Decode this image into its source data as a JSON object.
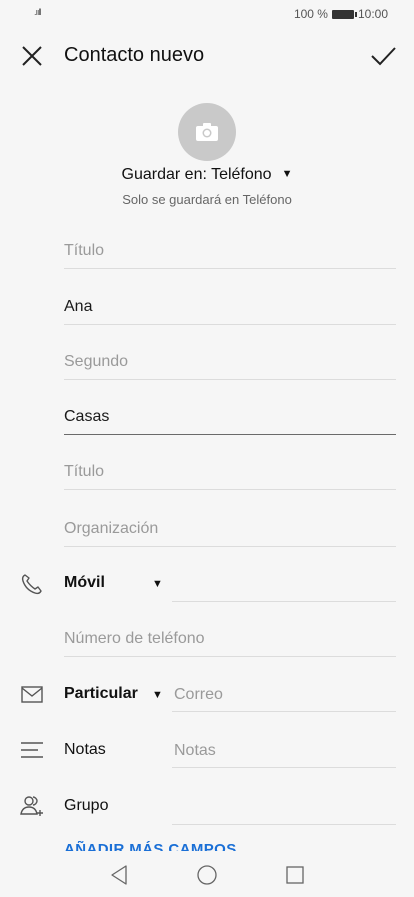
{
  "status": {
    "battery_text": "100 %",
    "time": "10:00",
    "signal": ".ııll"
  },
  "header": {
    "title": "Contacto nuevo"
  },
  "save_location": {
    "label": "Guardar en: Teléfono",
    "caret": "▼",
    "note": "Solo se guardará en Teléfono"
  },
  "fields": {
    "prefix": {
      "placeholder": "Título",
      "value": ""
    },
    "first_name": {
      "placeholder": "",
      "value": "Ana"
    },
    "middle_name": {
      "placeholder": "Segundo",
      "value": ""
    },
    "last_name": {
      "placeholder": "",
      "value": "Casas"
    },
    "suffix": {
      "placeholder": "Título",
      "value": ""
    },
    "organization": {
      "placeholder": "Organización",
      "value": ""
    }
  },
  "phone": {
    "type_label": "Móvil",
    "caret": "▼",
    "placeholder": "Número de teléfono"
  },
  "email": {
    "type_label": "Particular",
    "caret": "▼",
    "placeholder": "Correo"
  },
  "notes": {
    "label": "Notas",
    "placeholder": "Notas"
  },
  "group": {
    "label": "Grupo"
  },
  "more_fields": {
    "label": "AÑADIR MÁS CAMPOS"
  },
  "icons": {
    "close": "close-icon",
    "check": "check-icon",
    "camera": "camera-icon",
    "phone": "phone-icon",
    "email": "mail-icon",
    "notes": "notes-icon",
    "group": "group-icon",
    "nav_back": "back-icon",
    "nav_home": "home-icon",
    "nav_recent": "recent-apps-icon"
  },
  "colors": {
    "accent": "#1a6fd6",
    "avatar": "#c9c9c9",
    "background": "#f6f6f6"
  }
}
